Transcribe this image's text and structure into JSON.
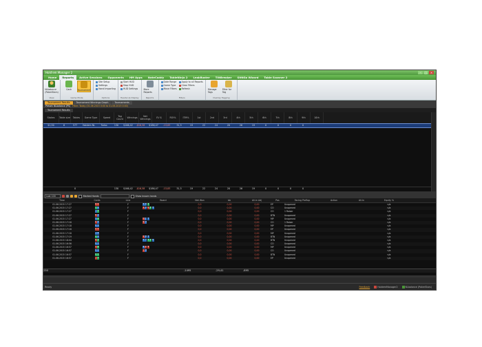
{
  "window": {
    "title": "Hold'em Manager 2"
  },
  "menu": [
    "Home",
    "Reports",
    "Active Sessions",
    "Opponents",
    "HM Apps",
    "NoteCaddy",
    "TableNinja 2",
    "LeakBuster",
    "TiltBreaker",
    "SitNGo Wizard",
    "Table Scanner 2"
  ],
  "menu_active": 1,
  "ribbon": {
    "view": {
      "hero": "NLbalance (PokerStars)",
      "label": "View"
    },
    "game_mode": {
      "cash": "Cash",
      "tournament": "Tournament",
      "label": "Game Mode"
    },
    "options": {
      "items": [
        "Site Setup",
        "Settings",
        "Hand Importing"
      ],
      "label": "Options"
    },
    "heads_up": {
      "items": [
        "Start HUD",
        "Stop HUD",
        "HUD Settings"
      ],
      "label": "Heads-Up Display"
    },
    "reports": {
      "button": "More Reports",
      "label": "Reports"
    },
    "filters": {
      "items": [
        "Date Range",
        "Game Type",
        "Move Filters"
      ],
      "items2": [
        "Apply to all Reports",
        "Clear Filters",
        "Refresh"
      ],
      "label": "Filters"
    },
    "tagging": {
      "manage": "Manage Tags",
      "filter": "Filter for Tag",
      "label": "Overlay Tagging"
    }
  },
  "tabs": [
    "Tournament Results",
    "Tournament Winnings Graph",
    "Tournaments"
  ],
  "filter_text": {
    "preset": "Preset: NLbalance (PS)",
    "filter": "Filter: Today (01.06.2015 0:00 to 01.06.2015 0:00)"
  },
  "tab2": [
    "Tournament Results"
  ],
  "upper_table": {
    "headers": [
      "Stakes",
      "Table size",
      "Tables",
      "Game Type",
      "Speed",
      "Tag Count",
      "Winnings",
      "Net Winnings",
      "EV $",
      "ROI%",
      "ITM%",
      "1st",
      "2nd",
      "3rd",
      "4th",
      "5th",
      "6th",
      "7th",
      "8th",
      "9th",
      "10th"
    ],
    "row": [
      "$1,50",
      "6",
      "577",
      "Holdem NL",
      "Turbo",
      "130",
      "$166,42",
      "-$16,58",
      "$186,47",
      "-13,83",
      "31,5",
      "19",
      "22",
      "24",
      "20",
      "26",
      "19",
      "0",
      "0",
      "0",
      "0"
    ],
    "totals": [
      "",
      "",
      "0",
      "",
      "",
      "130",
      "$166,42",
      "-$16,58",
      "$186,47",
      "-13,83",
      "31,5",
      "19",
      "22",
      "24",
      "20",
      "26",
      "19",
      "0",
      "0",
      "0",
      "0"
    ]
  },
  "lower_toolbar": {
    "limit": "Last 100",
    "chk1": "Marked Hands",
    "chk2": "Show known hands"
  },
  "lower_table": {
    "headers": [
      "Time",
      "Cards",
      "Line",
      "Board",
      "Net Won",
      "bb",
      "All-In Adj",
      "Pos",
      "Facing Preflop",
      "Action",
      "All-In",
      "Equity %"
    ],
    "rows": [
      {
        "time": "01.06.2015 17:27",
        "cards": [
          [
            "Q",
            "#c0392b"
          ],
          [
            "6",
            "#c0392b"
          ]
        ],
        "line": "F",
        "board": [
          [
            "5",
            "#2c6fbf"
          ],
          [
            "8",
            "#2c6fbf"
          ],
          [
            "3",
            "#27ae60"
          ]
        ],
        "net": "0,0",
        "bb": "0,00",
        "adj": "0,00",
        "pos": "EP",
        "facing": "Unopened",
        "eq": "n/a"
      },
      {
        "time": "01.06.2015 17:27",
        "cards": [
          [
            "7",
            "#27ae60"
          ],
          [
            "5",
            "#2c6fbf"
          ]
        ],
        "line": "F",
        "board": [
          [
            "2",
            "#c0392b"
          ],
          [
            "4",
            "#2c6fbf"
          ],
          [
            "K",
            "#c0392b"
          ],
          [
            "9",
            "#27ae60"
          ],
          [
            "3",
            "#2c6fbf"
          ]
        ],
        "net": "0,0",
        "bb": "0,00",
        "adj": "0,00",
        "pos": "CO",
        "facing": "Unopened",
        "eq": "n/a"
      },
      {
        "time": "01.06.2015 17:27",
        "cards": [
          [
            "J",
            "#2c6fbf"
          ],
          [
            "3",
            "#27ae60"
          ]
        ],
        "line": "F",
        "board": [],
        "net": "0,0",
        "bb": "0,00",
        "adj": "0,00",
        "pos": "CO",
        "facing": "1 Raiser",
        "eq": "n/a"
      },
      {
        "time": "01.06.2015 17:27",
        "cards": [
          [
            "8",
            "#c0392b"
          ],
          [
            "4",
            "#2c6fbf"
          ]
        ],
        "line": "F",
        "board": [],
        "net": "0,0",
        "bb": "0,00",
        "adj": "0,00",
        "pos": "BTN",
        "facing": "Unopened",
        "eq": "n/a"
      },
      {
        "time": "01.06.2015 17:27",
        "cards": [
          [
            "T",
            "#2c6fbf"
          ],
          [
            "2",
            "#27ae60"
          ]
        ],
        "line": "F",
        "board": [
          [
            "Q",
            "#c0392b"
          ],
          [
            "J",
            "#2c6fbf"
          ],
          [
            "7",
            "#2c6fbf"
          ]
        ],
        "net": "0,0",
        "bb": "0,00",
        "adj": "0,00",
        "pos": "MP",
        "facing": "Unopened",
        "eq": "n/a"
      },
      {
        "time": "01.06.2015 17:18",
        "cards": [
          [
            "K",
            "#c0392b"
          ],
          [
            "5",
            "#2c6fbf"
          ]
        ],
        "line": "F",
        "board": [
          [
            "9",
            "#c0392b"
          ],
          [
            "4",
            "#2c6fbf"
          ]
        ],
        "net": "0,0",
        "bb": "0,00",
        "adj": "0,00",
        "pos": "CO",
        "facing": "1 Raiser",
        "eq": "n/a"
      },
      {
        "time": "01.06.2015 17:18",
        "cards": [
          [
            "6",
            "#2c6fbf"
          ],
          [
            "3",
            "#2c6fbf"
          ]
        ],
        "line": "F",
        "board": [],
        "net": "0,0",
        "bb": "0,00",
        "adj": "0,00",
        "pos": "MP",
        "facing": "Unopened",
        "eq": "n/a"
      },
      {
        "time": "01.06.2015 17:18",
        "cards": [
          [
            "A",
            "#c0392b"
          ],
          [
            "9",
            "#c0392b"
          ]
        ],
        "line": "F",
        "board": [],
        "net": "0,0",
        "bb": "0,00",
        "adj": "0,00",
        "pos": "EP",
        "facing": "Unopened",
        "eq": "n/a"
      },
      {
        "time": "01.06.2015 17:18",
        "cards": [
          [
            "J",
            "#2c6fbf"
          ],
          [
            "8",
            "#2c6fbf"
          ]
        ],
        "line": "F",
        "board": [],
        "net": "0,0",
        "bb": "0,00",
        "adj": "0,00",
        "pos": "MP",
        "facing": "Unopened",
        "eq": "n/a"
      },
      {
        "time": "01.06.2015 17:19",
        "cards": [
          [
            "4",
            "#27ae60"
          ],
          [
            "2",
            "#2c6fbf"
          ]
        ],
        "line": "F",
        "board": [
          [
            "K",
            "#c0392b"
          ],
          [
            "8",
            "#2c6fbf"
          ],
          [
            "3",
            "#2c6fbf"
          ]
        ],
        "net": "0,0",
        "bb": "0,00",
        "adj": "0,00",
        "pos": "BTN",
        "facing": "Unopened",
        "eq": "n/a"
      },
      {
        "time": "01.06.2015 18:04",
        "cards": [
          [
            "9",
            "#c0392b"
          ],
          [
            "7",
            "#27ae60"
          ]
        ],
        "line": "F",
        "board": [
          [
            "5",
            "#2c6fbf"
          ],
          [
            "7",
            "#2c6fbf"
          ],
          [
            "3",
            "#27ae60"
          ],
          [
            "2",
            "#27ae60"
          ],
          [
            "K",
            "#2c6fbf"
          ]
        ],
        "net": "0,0",
        "bb": "0,00",
        "adj": "0,00",
        "pos": "BTN",
        "facing": "Unopened",
        "eq": "n/a"
      },
      {
        "time": "01.06.2015 16:56",
        "cards": [
          [
            "Q",
            "#2c6fbf"
          ],
          [
            "3",
            "#2c6fbf"
          ]
        ],
        "line": "F",
        "board": [],
        "net": "0,0",
        "bb": "0,00",
        "adj": "0,00",
        "pos": "CO",
        "facing": "Unopened",
        "eq": "n/a"
      },
      {
        "time": "01.06.2015 16:57",
        "cards": [
          [
            "T",
            "#c0392b"
          ],
          [
            "6",
            "#27ae60"
          ]
        ],
        "line": "F",
        "board": [
          [
            "6",
            "#2c6fbf"
          ],
          [
            "A",
            "#c0392b"
          ],
          [
            "8",
            "#c0392b"
          ]
        ],
        "net": "0,0",
        "bb": "0,00",
        "adj": "0,00",
        "pos": "MP",
        "facing": "Unopened",
        "eq": "n/a"
      },
      {
        "time": "01.06.2015 16:57",
        "cards": [
          [
            "K",
            "#2c6fbf"
          ],
          [
            "2",
            "#2c6fbf"
          ]
        ],
        "line": "F",
        "board": [
          [
            "J",
            "#c0392b"
          ],
          [
            "9",
            "#2c6fbf"
          ]
        ],
        "net": "0,0",
        "bb": "0,00",
        "adj": "0,00",
        "pos": "CO",
        "facing": "Unopened",
        "eq": "n/a"
      },
      {
        "time": "01.06.2015 16:57",
        "cards": [
          [
            "8",
            "#27ae60"
          ],
          [
            "5",
            "#27ae60"
          ]
        ],
        "line": "F",
        "board": [],
        "net": "0,0",
        "bb": "0,00",
        "adj": "0,00",
        "pos": "BTN",
        "facing": "Unopened",
        "eq": "n/a"
      },
      {
        "time": "01.06.2015 16:57",
        "cards": [
          [
            "J",
            "#c0392b"
          ],
          [
            "7",
            "#27ae60"
          ]
        ],
        "line": "F",
        "board": [],
        "net": "0,0",
        "bb": "0,00",
        "adj": "0,00",
        "pos": "EP",
        "facing": "Unopened",
        "eq": "n/a"
      }
    ],
    "totals": {
      "count": "230",
      "net": "-1495",
      "bb": "-29,41",
      "adj": "-895"
    }
  },
  "status": {
    "left": "Ready",
    "feedback": "Feedback",
    "db1": "HoldemManager2",
    "db2": "NLbalance (PokerStars)"
  }
}
